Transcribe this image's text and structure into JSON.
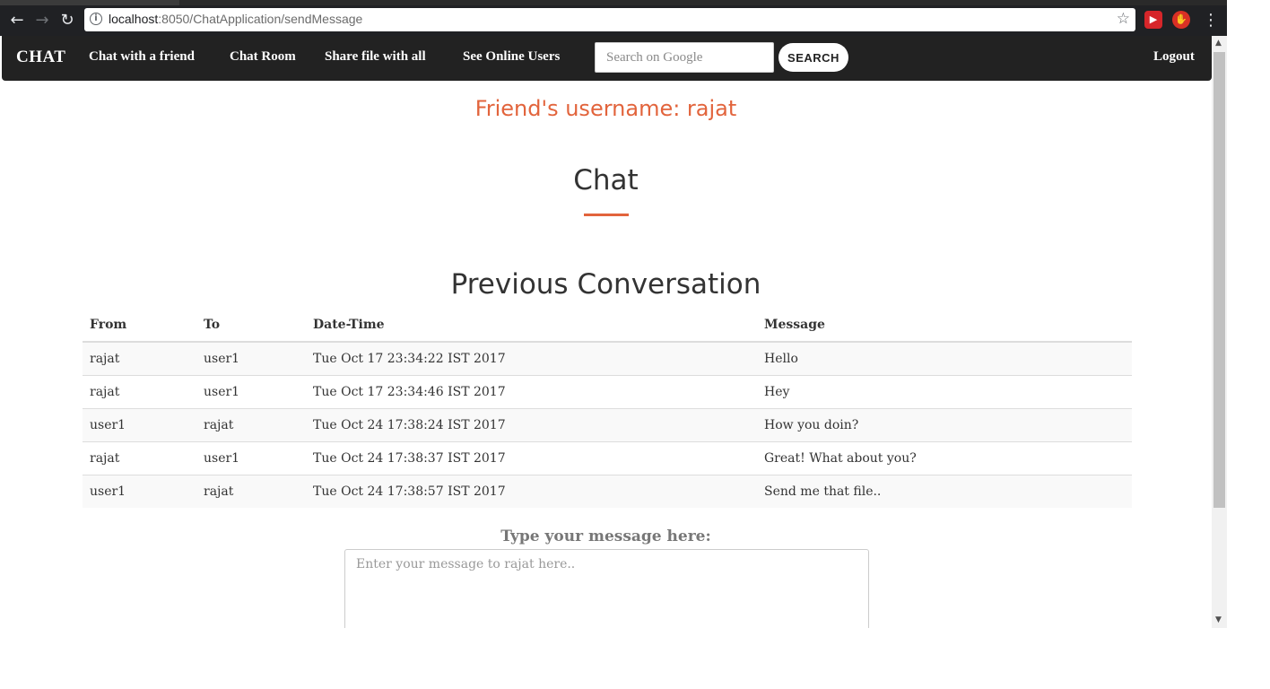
{
  "browser": {
    "url_host": "localhost",
    "url_rest": ":8050/ChatApplication/sendMessage"
  },
  "navbar": {
    "brand": "CHAT",
    "links": [
      "Chat with a friend",
      "Chat Room",
      "Share file with all",
      "See Online Users"
    ],
    "search_placeholder": "Search on Google",
    "search_button": "SEARCH",
    "logout": "Logout"
  },
  "friend_heading": "Friend's username: rajat",
  "chat_title": "Chat",
  "conversation": {
    "title": "Previous Conversation",
    "columns": [
      "From",
      "To",
      "Date-Time",
      "Message"
    ],
    "rows": [
      [
        "rajat",
        "user1",
        "Tue Oct 17 23:34:22 IST 2017",
        "Hello"
      ],
      [
        "rajat",
        "user1",
        "Tue Oct 17 23:34:46 IST 2017",
        "Hey"
      ],
      [
        "user1",
        "rajat",
        "Tue Oct 24 17:38:24 IST 2017",
        "How you doin?"
      ],
      [
        "rajat",
        "user1",
        "Tue Oct 24 17:38:37 IST 2017",
        "Great! What about you?"
      ],
      [
        "user1",
        "rajat",
        "Tue Oct 24 17:38:57 IST 2017",
        "Send me that file.."
      ]
    ]
  },
  "compose": {
    "label": "Type your message here:",
    "placeholder": "Enter your message to rajat here.."
  },
  "colors": {
    "accent": "#e2643c",
    "navbar": "#222222"
  }
}
